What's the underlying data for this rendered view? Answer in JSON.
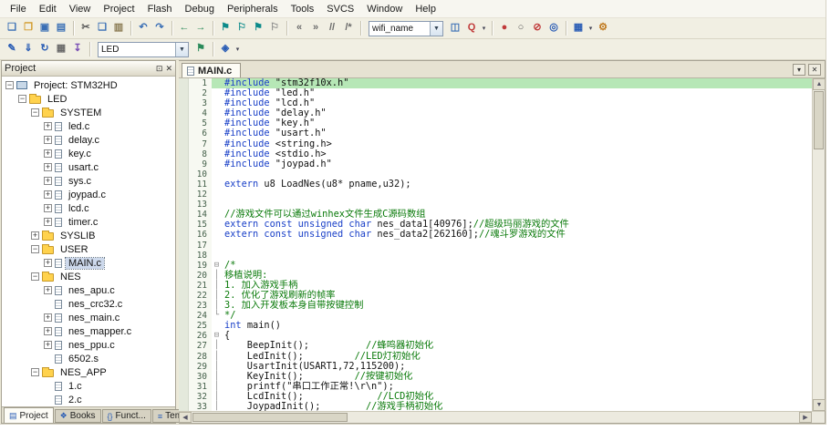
{
  "colors": {
    "keyword": "#1a40c8",
    "comment": "#0a7a0a",
    "string": "#101010",
    "text": "#141414",
    "line_highlight": "#b6e7b6",
    "selection": "#cdd9ec"
  },
  "menu": {
    "items": [
      "File",
      "Edit",
      "View",
      "Project",
      "Flash",
      "Debug",
      "Peripherals",
      "Tools",
      "SVCS",
      "Window",
      "Help"
    ]
  },
  "toolbar1": {
    "items": [
      {
        "type": "icon",
        "name": "new-file",
        "glyph": "❏",
        "color": "#3a6fb5"
      },
      {
        "type": "icon",
        "name": "open-file",
        "glyph": "❐",
        "color": "#d29a2a"
      },
      {
        "type": "icon",
        "name": "save",
        "glyph": "▣",
        "color": "#3a6fb5"
      },
      {
        "type": "icon",
        "name": "save-all",
        "glyph": "▤",
        "color": "#3a6fb5"
      },
      {
        "type": "sep"
      },
      {
        "type": "icon",
        "name": "cut",
        "glyph": "✂",
        "color": "#5a5a5a"
      },
      {
        "type": "icon",
        "name": "copy",
        "glyph": "❑",
        "color": "#3a6fb5"
      },
      {
        "type": "icon",
        "name": "paste",
        "glyph": "▥",
        "color": "#8a7a52"
      },
      {
        "type": "sep"
      },
      {
        "type": "icon",
        "name": "undo",
        "glyph": "↶",
        "color": "#3a6fb5"
      },
      {
        "type": "icon",
        "name": "redo",
        "glyph": "↷",
        "color": "#3a6fb5"
      },
      {
        "type": "sep"
      },
      {
        "type": "icon",
        "name": "navigate-back",
        "glyph": "←",
        "color": "#2a8a5a"
      },
      {
        "type": "icon",
        "name": "navigate-forward",
        "glyph": "→",
        "color": "#2a8a5a"
      },
      {
        "type": "sep"
      },
      {
        "type": "icon",
        "name": "toggle-bookmark",
        "glyph": "⚑",
        "color": "#0a8a8a"
      },
      {
        "type": "icon",
        "name": "previous-bookmark",
        "glyph": "⚐",
        "color": "#0a8a8a"
      },
      {
        "type": "icon",
        "name": "next-bookmark",
        "glyph": "⚑",
        "color": "#0a8a8a"
      },
      {
        "type": "icon",
        "name": "clear-all-bookmarks",
        "glyph": "⚐",
        "color": "#8a8a8a"
      },
      {
        "type": "sep"
      },
      {
        "type": "icon",
        "name": "indent-left",
        "glyph": "«",
        "color": "#6a6a6a"
      },
      {
        "type": "icon",
        "name": "indent-right",
        "glyph": "»",
        "color": "#6a6a6a"
      },
      {
        "type": "icon",
        "name": "comment-selection",
        "glyph": "//",
        "color": "#6a6a6a"
      },
      {
        "type": "icon",
        "name": "uncomment-selection",
        "glyph": "/*",
        "color": "#6a6a6a"
      },
      {
        "type": "sep"
      },
      {
        "type": "combo",
        "name": "find-text",
        "value": "wifi_name",
        "width": 66
      },
      {
        "type": "icon",
        "name": "find-in-files",
        "glyph": "◫",
        "color": "#3a6fb5"
      },
      {
        "type": "icon",
        "name": "find",
        "glyph": "Q",
        "color": "#c03a3a",
        "dd": true
      },
      {
        "type": "sep"
      },
      {
        "type": "icon",
        "name": "insert-remove-breakpoint",
        "glyph": "●",
        "color": "#c03a3a"
      },
      {
        "type": "icon",
        "name": "enable-disable-breakpoint",
        "glyph": "○",
        "color": "#5a5a5a"
      },
      {
        "type": "icon",
        "name": "disable-all-breakpoints",
        "glyph": "⊘",
        "color": "#c03a3a"
      },
      {
        "type": "icon",
        "name": "kill-all-breakpoints",
        "glyph": "◎",
        "color": "#2a5db5"
      },
      {
        "type": "sep"
      },
      {
        "type": "icon",
        "name": "window-layout",
        "glyph": "▦",
        "color": "#2a5db5",
        "dd": true
      },
      {
        "type": "icon",
        "name": "configure-tools",
        "glyph": "⚙",
        "color": "#c07a20"
      }
    ]
  },
  "toolbar2": {
    "items": [
      {
        "type": "icon",
        "name": "translate-file",
        "glyph": "✎",
        "color": "#2a5db5"
      },
      {
        "type": "icon",
        "name": "build-target",
        "glyph": "⇓",
        "color": "#2a5db5"
      },
      {
        "type": "icon",
        "name": "rebuild-all",
        "glyph": "↻",
        "color": "#2a5db5"
      },
      {
        "type": "icon",
        "name": "batch-build",
        "glyph": "▦",
        "color": "#6a6a6a"
      },
      {
        "type": "icon",
        "name": "download-to-flash",
        "glyph": "↧",
        "color": "#7a4fb5"
      },
      {
        "type": "sep"
      },
      {
        "type": "combo",
        "name": "select-target",
        "value": "LED",
        "width": 84
      },
      {
        "type": "icon",
        "name": "options-for-target",
        "glyph": "⚑",
        "color": "#2a8a5a"
      },
      {
        "type": "sep"
      },
      {
        "type": "icon",
        "name": "manage-run-time-environment",
        "glyph": "◈",
        "color": "#2a5db5",
        "dd": true
      }
    ]
  },
  "project_panel": {
    "title": "Project",
    "icons": {
      "dock": "⊡",
      "close": "✕"
    },
    "tree": [
      {
        "d": 0,
        "exp": "minus",
        "icon": "target",
        "label": "Project: STM32HD"
      },
      {
        "d": 1,
        "exp": "minus",
        "icon": "folder",
        "label": "LED"
      },
      {
        "d": 2,
        "exp": "minus",
        "icon": "folder",
        "label": "SYSTEM"
      },
      {
        "d": 3,
        "exp": "plus",
        "icon": "file",
        "label": "led.c"
      },
      {
        "d": 3,
        "exp": "plus",
        "icon": "file",
        "label": "delay.c"
      },
      {
        "d": 3,
        "exp": "plus",
        "icon": "file",
        "label": "key.c"
      },
      {
        "d": 3,
        "exp": "plus",
        "icon": "file",
        "label": "usart.c"
      },
      {
        "d": 3,
        "exp": "plus",
        "icon": "file",
        "label": "sys.c"
      },
      {
        "d": 3,
        "exp": "plus",
        "icon": "file",
        "label": "joypad.c"
      },
      {
        "d": 3,
        "exp": "plus",
        "icon": "file",
        "label": "lcd.c"
      },
      {
        "d": 3,
        "exp": "plus",
        "icon": "file",
        "label": "timer.c"
      },
      {
        "d": 2,
        "exp": "plus",
        "icon": "folder",
        "label": "SYSLIB"
      },
      {
        "d": 2,
        "exp": "minus",
        "icon": "folder",
        "label": "USER"
      },
      {
        "d": 3,
        "exp": "plus",
        "icon": "file",
        "label": "MAIN.c",
        "selected": true
      },
      {
        "d": 2,
        "exp": "minus",
        "icon": "folder",
        "label": "NES"
      },
      {
        "d": 3,
        "exp": "plus",
        "icon": "file",
        "label": "nes_apu.c"
      },
      {
        "d": 3,
        "exp": null,
        "icon": "file",
        "label": "nes_crc32.c"
      },
      {
        "d": 3,
        "exp": "plus",
        "icon": "file",
        "label": "nes_main.c"
      },
      {
        "d": 3,
        "exp": "plus",
        "icon": "file",
        "label": "nes_mapper.c"
      },
      {
        "d": 3,
        "exp": "plus",
        "icon": "file",
        "label": "nes_ppu.c"
      },
      {
        "d": 3,
        "exp": null,
        "icon": "file",
        "label": "6502.s"
      },
      {
        "d": 2,
        "exp": "minus",
        "icon": "folder",
        "label": "NES_APP"
      },
      {
        "d": 3,
        "exp": null,
        "icon": "file",
        "label": "1.c"
      },
      {
        "d": 3,
        "exp": null,
        "icon": "file",
        "label": "2.c"
      }
    ],
    "tabs": [
      {
        "icon": "▤",
        "label": "Project",
        "active": true
      },
      {
        "icon": "❖",
        "label": "Books",
        "active": false
      },
      {
        "icon": "{}",
        "label": "Funct...",
        "active": false
      },
      {
        "icon": "≡",
        "label": "Templ...",
        "active": false
      }
    ]
  },
  "editor": {
    "tab": "MAIN.c",
    "controls": {
      "menu": "▾",
      "close": "✕"
    },
    "lines": [
      {
        "n": 1,
        "hl": true,
        "seg": [
          [
            "kw",
            "#include "
          ],
          [
            "str",
            "\"stm32f10x.h\""
          ]
        ]
      },
      {
        "n": 2,
        "seg": [
          [
            "kw",
            "#include "
          ],
          [
            "str",
            "\"led.h\""
          ]
        ]
      },
      {
        "n": 3,
        "seg": [
          [
            "kw",
            "#include "
          ],
          [
            "str",
            "\"lcd.h\""
          ]
        ]
      },
      {
        "n": 4,
        "seg": [
          [
            "kw",
            "#include "
          ],
          [
            "str",
            "\"delay.h\""
          ]
        ]
      },
      {
        "n": 5,
        "seg": [
          [
            "kw",
            "#include "
          ],
          [
            "str",
            "\"key.h\""
          ]
        ]
      },
      {
        "n": 6,
        "seg": [
          [
            "kw",
            "#include "
          ],
          [
            "str",
            "\"usart.h\""
          ]
        ]
      },
      {
        "n": 7,
        "seg": [
          [
            "kw",
            "#include "
          ],
          [
            "str",
            "<string.h>"
          ]
        ]
      },
      {
        "n": 8,
        "seg": [
          [
            "kw",
            "#include "
          ],
          [
            "str",
            "<stdio.h>"
          ]
        ]
      },
      {
        "n": 9,
        "seg": [
          [
            "kw",
            "#include "
          ],
          [
            "str",
            "\"joypad.h\""
          ]
        ]
      },
      {
        "n": 10,
        "seg": []
      },
      {
        "n": 11,
        "seg": [
          [
            "kw",
            "extern "
          ],
          [
            "t",
            "u8 LoadNes(u8* pname,u32);"
          ]
        ]
      },
      {
        "n": 12,
        "seg": []
      },
      {
        "n": 13,
        "seg": []
      },
      {
        "n": 14,
        "seg": [
          [
            "cm",
            "//游戏文件可以通过winhex文件生成C源码数组"
          ]
        ]
      },
      {
        "n": 15,
        "seg": [
          [
            "kw",
            "extern const unsigned char "
          ],
          [
            "t",
            "nes_data1[40976];"
          ],
          [
            "cm",
            "//超级玛丽游戏的文件"
          ]
        ]
      },
      {
        "n": 16,
        "seg": [
          [
            "kw",
            "extern const unsigned char "
          ],
          [
            "t",
            "nes_data2[262160];"
          ],
          [
            "cm",
            "//魂斗罗游戏的文件"
          ]
        ]
      },
      {
        "n": 17,
        "seg": []
      },
      {
        "n": 18,
        "seg": []
      },
      {
        "n": 19,
        "fold": "open",
        "seg": [
          [
            "cm",
            "/*"
          ]
        ]
      },
      {
        "n": 20,
        "fold": "line",
        "seg": [
          [
            "cm",
            "移植说明:"
          ]
        ]
      },
      {
        "n": 21,
        "fold": "line",
        "seg": [
          [
            "cm",
            "1. 加入游戏手柄"
          ]
        ]
      },
      {
        "n": 22,
        "fold": "line",
        "seg": [
          [
            "cm",
            "2. 优化了游戏刷新的帧率"
          ]
        ]
      },
      {
        "n": 23,
        "fold": "line",
        "seg": [
          [
            "cm",
            "3. 加入开发板本身自带按键控制"
          ]
        ]
      },
      {
        "n": 24,
        "fold": "end",
        "seg": [
          [
            "cm",
            "*/"
          ]
        ]
      },
      {
        "n": 25,
        "seg": [
          [
            "kw",
            "int "
          ],
          [
            "t",
            "main()"
          ]
        ]
      },
      {
        "n": 26,
        "fold": "open",
        "seg": [
          [
            "t",
            "{"
          ]
        ]
      },
      {
        "n": 27,
        "fold": "line",
        "seg": [
          [
            "t",
            "    BeepInit();"
          ],
          [
            "cm",
            "          //蜂鸣器初始化"
          ]
        ]
      },
      {
        "n": 28,
        "fold": "line",
        "seg": [
          [
            "t",
            "    LedInit();"
          ],
          [
            "cm",
            "         //LED灯初始化"
          ]
        ]
      },
      {
        "n": 29,
        "fold": "line",
        "seg": [
          [
            "t",
            "    UsartInit(USART1,72,115200);"
          ]
        ]
      },
      {
        "n": 30,
        "fold": "line",
        "seg": [
          [
            "t",
            "    KeyInit();"
          ],
          [
            "cm",
            "         //按键初始化"
          ]
        ]
      },
      {
        "n": 31,
        "fold": "line",
        "seg": [
          [
            "t",
            "    printf("
          ],
          [
            "str",
            "\"串口工作正常!\\r\\n\""
          ],
          [
            "t",
            ");"
          ]
        ]
      },
      {
        "n": 32,
        "fold": "line",
        "seg": [
          [
            "t",
            "    LcdInit();"
          ],
          [
            "cm",
            "             //LCD初始化"
          ]
        ]
      },
      {
        "n": 33,
        "fold": "line",
        "seg": [
          [
            "t",
            "    JoypadInit();"
          ],
          [
            "cm",
            "        //游戏手柄初始化"
          ]
        ]
      }
    ]
  },
  "scrollbar": {
    "up": "▲",
    "down": "▼",
    "left": "◀",
    "right": "▶"
  }
}
